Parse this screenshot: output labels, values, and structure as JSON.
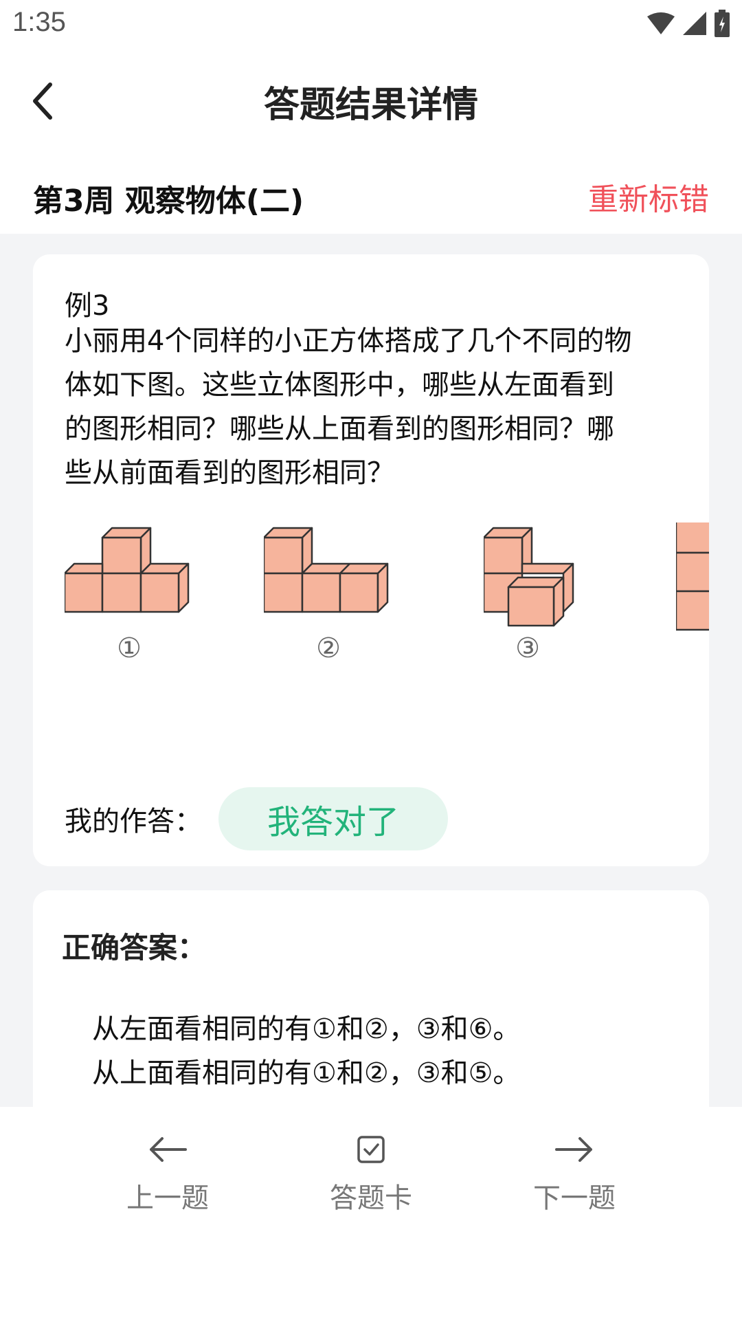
{
  "status_bar": {
    "time": "1:35",
    "icons": [
      "wifi-icon",
      "signal-icon",
      "battery-icon"
    ]
  },
  "header": {
    "title": "答题结果详情",
    "back_icon": "chevron-left-icon"
  },
  "subheader": {
    "week_title": "第3周 观察物体(二)",
    "remark_label": "重新标错"
  },
  "question": {
    "label": "例3",
    "lines": [
      "小丽用4个同样的小正方体搭成了几个不同的物",
      "体如下图。这些立体图形中，哪些从左面看到",
      "的图形相同？哪些从上面看到的图形相同？哪",
      "些从前面看到的图形相同？"
    ],
    "figure_labels": [
      "①",
      "②",
      "③"
    ]
  },
  "my_answer": {
    "label": "我的作答：",
    "value": "我答对了"
  },
  "correct_answer": {
    "title": "正确答案：",
    "lines": [
      "从左面看相同的有①和②，③和⑥。",
      "从上面看相同的有①和②，③和⑤。"
    ]
  },
  "bottom_nav": {
    "prev_label": "上一题",
    "card_label": "答题卡",
    "next_label": "下一题"
  },
  "colors": {
    "accent_red": "#f0515a",
    "success_green": "#22b37a",
    "success_bg": "#e6f6ef",
    "cube_fill": "#f6b49c"
  }
}
